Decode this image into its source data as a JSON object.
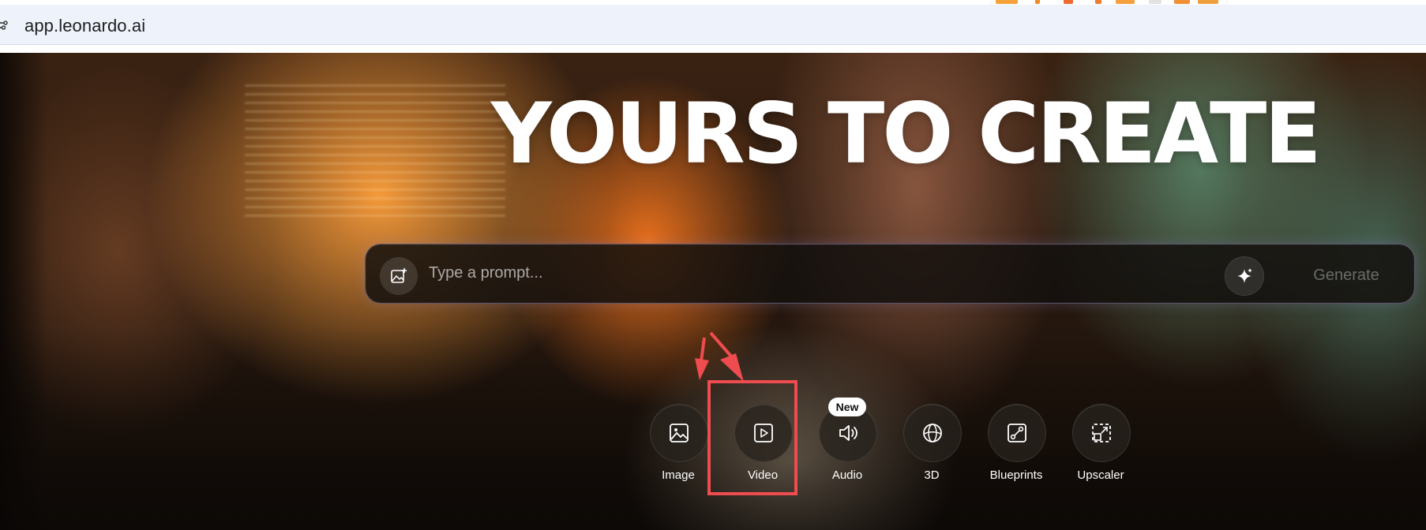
{
  "browser": {
    "url": "app.leonardo.ai",
    "extension_colors": [
      "#f5a23a",
      "#f28c28",
      "#f06a2e",
      "#f07a30",
      "#f59f3d",
      "#e9e9e9",
      "#f08f33",
      "#f0a03a"
    ]
  },
  "hero": {
    "headline": "YOURS TO CREATE"
  },
  "prompt": {
    "placeholder": "Type a prompt...",
    "generate_label": "Generate",
    "upload_icon": "image-add-icon",
    "enhance_icon": "sparkle-icon"
  },
  "tools": [
    {
      "label": "Image",
      "icon": "image-icon"
    },
    {
      "label": "Video",
      "icon": "play-icon"
    },
    {
      "label": "Audio",
      "icon": "speaker-icon",
      "badge": "New"
    },
    {
      "label": "3D",
      "icon": "globe-icon"
    },
    {
      "label": "Blueprints",
      "icon": "blueprint-icon"
    },
    {
      "label": "Upscaler",
      "icon": "upscale-icon"
    }
  ],
  "annotation": {
    "color": "#ee4c4f",
    "highlighted_tool": "Video"
  }
}
